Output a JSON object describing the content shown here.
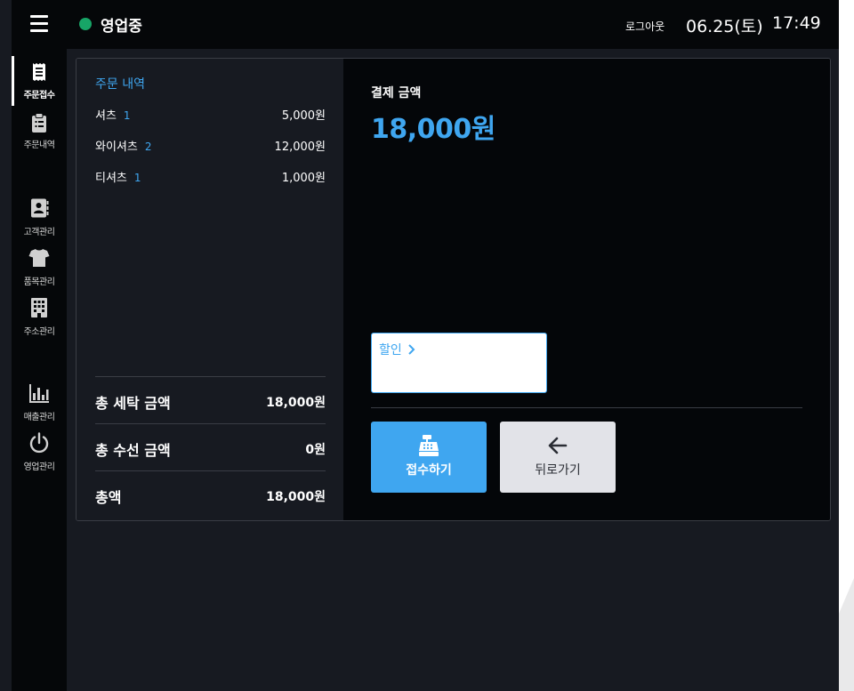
{
  "header": {
    "status": "영업중",
    "logout_label": "로그아웃",
    "date": "06.25(토)",
    "time": "17:49",
    "status_color": "#17a567"
  },
  "sidebar": {
    "items": [
      {
        "label": "주문접수",
        "icon": "receipt-icon",
        "active": true
      },
      {
        "label": "주문내역",
        "icon": "clipboard-icon"
      },
      {
        "label": "고객관리",
        "icon": "contact-book-icon"
      },
      {
        "label": "품목관리",
        "icon": "tshirt-icon"
      },
      {
        "label": "주소관리",
        "icon": "building-icon"
      },
      {
        "label": "매출관리",
        "icon": "bar-chart-icon"
      },
      {
        "label": "영업관리",
        "icon": "power-icon"
      }
    ]
  },
  "order": {
    "section_title": "주문 내역",
    "items": [
      {
        "name": "셔츠",
        "qty": "1",
        "price": "5,000원"
      },
      {
        "name": "와이셔츠",
        "qty": "2",
        "price": "12,000원"
      },
      {
        "name": "티셔츠",
        "qty": "1",
        "price": "1,000원"
      }
    ],
    "totals": [
      {
        "label": "총 세탁 금액",
        "value": "18,000원"
      },
      {
        "label": "총 수선 금액",
        "value": "0원"
      },
      {
        "label": "총액",
        "value": "18,000원"
      }
    ]
  },
  "payment": {
    "label": "결제 금액",
    "amount": "18,000원",
    "discount_label": "할인",
    "receive_button": "접수하기",
    "back_button": "뒤로가기",
    "accent_color": "#3fa6f0"
  }
}
